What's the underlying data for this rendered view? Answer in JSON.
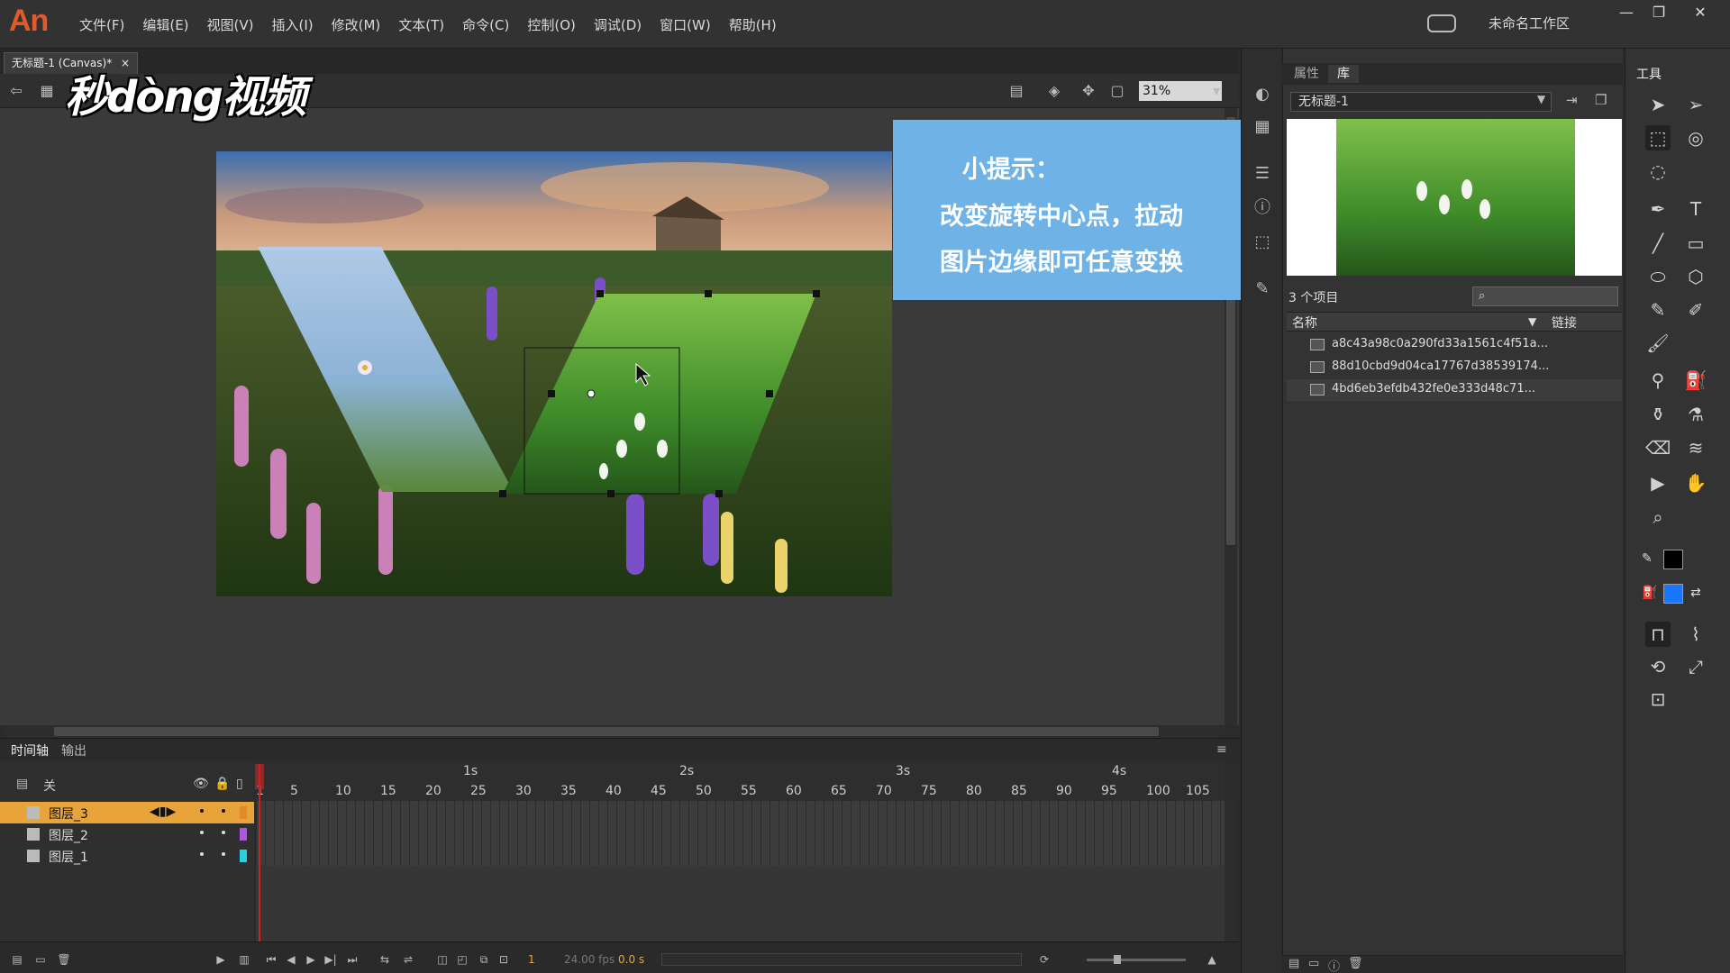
{
  "app": {
    "logo": "An",
    "menu": [
      "文件(F)",
      "编辑(E)",
      "视图(V)",
      "插入(I)",
      "修改(M)",
      "文本(T)",
      "命令(C)",
      "控制(O)",
      "调试(D)",
      "窗口(W)",
      "帮助(H)"
    ],
    "workspace": "未命名工作区",
    "window_controls": [
      "—",
      "❐",
      "✕"
    ]
  },
  "document": {
    "tab_label": "无标题-1 (Canvas)*",
    "tab_close": "×",
    "zoom": "31%"
  },
  "watermark": "秒dòng视频",
  "hint": {
    "title": "小提示：",
    "line1": "改变旋转中心点，拉动",
    "line2": "图片边缘即可任意变换"
  },
  "library": {
    "tabs": [
      "属性",
      "库"
    ],
    "doc_select": "无标题-1",
    "count": "3 个项目",
    "col_name": "名称",
    "col_link": "链接",
    "items": [
      "a8c43a98c0a290fd33a1561c4f51a...",
      "88d10cbd9d04ca17767d38539174...",
      "4bd6eb3efdb432fe0e333d48c71..."
    ]
  },
  "tools": {
    "title": "工具"
  },
  "timeline": {
    "tabs": [
      "时间轴",
      "输出"
    ],
    "header_label": "关",
    "layers": [
      {
        "name": "图层_3",
        "color": "#e08a2a",
        "active": true
      },
      {
        "name": "图层_2",
        "color": "#b055e0",
        "active": false
      },
      {
        "name": "图层_1",
        "color": "#2ad0e0",
        "active": false
      }
    ],
    "seconds": [
      "1s",
      "2s",
      "3s",
      "4s"
    ],
    "frame_numbers": [
      "1",
      "5",
      "10",
      "15",
      "20",
      "25",
      "30",
      "35",
      "40",
      "45",
      "50",
      "55",
      "60",
      "65",
      "70",
      "75",
      "80",
      "85",
      "90",
      "95",
      "100",
      "105"
    ],
    "current_frame": "1",
    "fps": "24.00 fps",
    "time": "0.0 s"
  },
  "colors": {
    "accent_orange": "#e35a2a",
    "hint_bg": "#6fb3e6",
    "fill_blue": "#1976ff",
    "stroke_black": "#000000"
  }
}
